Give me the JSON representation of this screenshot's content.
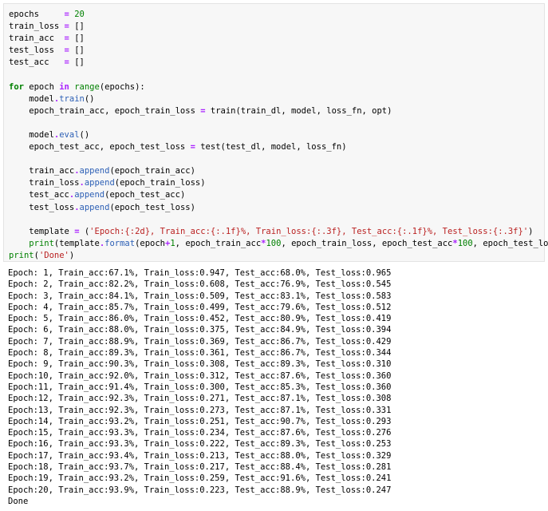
{
  "code": {
    "epochs_num": "20",
    "train_loss_list": "[]",
    "train_acc_list": "[]",
    "test_loss_list": "[]",
    "test_acc_list": "[]",
    "template_str": "'Epoch:{:2d}, Train_acc:{:.1f}%, Train_loss:{:.3f}, Test_acc:{:.1f}%, Test_loss:{:.3f}'",
    "num_1": "1",
    "num_100a": "100",
    "num_100b": "100",
    "done_str": "'Done'"
  },
  "output": {
    "lines": [
      "Epoch: 1, Train_acc:67.1%, Train_loss:0.947, Test_acc:68.0%, Test_loss:0.965",
      "Epoch: 2, Train_acc:82.2%, Train_loss:0.608, Test_acc:76.9%, Test_loss:0.545",
      "Epoch: 3, Train_acc:84.1%, Train_loss:0.509, Test_acc:83.1%, Test_loss:0.583",
      "Epoch: 4, Train_acc:85.7%, Train_loss:0.499, Test_acc:79.6%, Test_loss:0.512",
      "Epoch: 5, Train_acc:86.0%, Train_loss:0.452, Test_acc:80.9%, Test_loss:0.419",
      "Epoch: 6, Train_acc:88.0%, Train_loss:0.375, Test_acc:84.9%, Test_loss:0.394",
      "Epoch: 7, Train_acc:88.9%, Train_loss:0.369, Test_acc:86.7%, Test_loss:0.429",
      "Epoch: 8, Train_acc:89.3%, Train_loss:0.361, Test_acc:86.7%, Test_loss:0.344",
      "Epoch: 9, Train_acc:90.3%, Train_loss:0.308, Test_acc:89.3%, Test_loss:0.310",
      "Epoch:10, Train_acc:92.0%, Train_loss:0.312, Test_acc:87.6%, Test_loss:0.360",
      "Epoch:11, Train_acc:91.4%, Train_loss:0.300, Test_acc:85.3%, Test_loss:0.360",
      "Epoch:12, Train_acc:92.3%, Train_loss:0.271, Test_acc:87.1%, Test_loss:0.308",
      "Epoch:13, Train_acc:92.3%, Train_loss:0.273, Test_acc:87.1%, Test_loss:0.331",
      "Epoch:14, Train_acc:93.2%, Train_loss:0.251, Test_acc:90.7%, Test_loss:0.293",
      "Epoch:15, Train_acc:93.3%, Train_loss:0.234, Test_acc:87.6%, Test_loss:0.276",
      "Epoch:16, Train_acc:93.3%, Train_loss:0.222, Test_acc:89.3%, Test_loss:0.253",
      "Epoch:17, Train_acc:93.4%, Train_loss:0.213, Test_acc:88.0%, Test_loss:0.329",
      "Epoch:18, Train_acc:93.7%, Train_loss:0.217, Test_acc:88.4%, Test_loss:0.281",
      "Epoch:19, Train_acc:93.2%, Train_loss:0.259, Test_acc:91.6%, Test_loss:0.241",
      "Epoch:20, Train_acc:93.9%, Train_loss:0.223, Test_acc:88.9%, Test_loss:0.247",
      "Done"
    ]
  }
}
